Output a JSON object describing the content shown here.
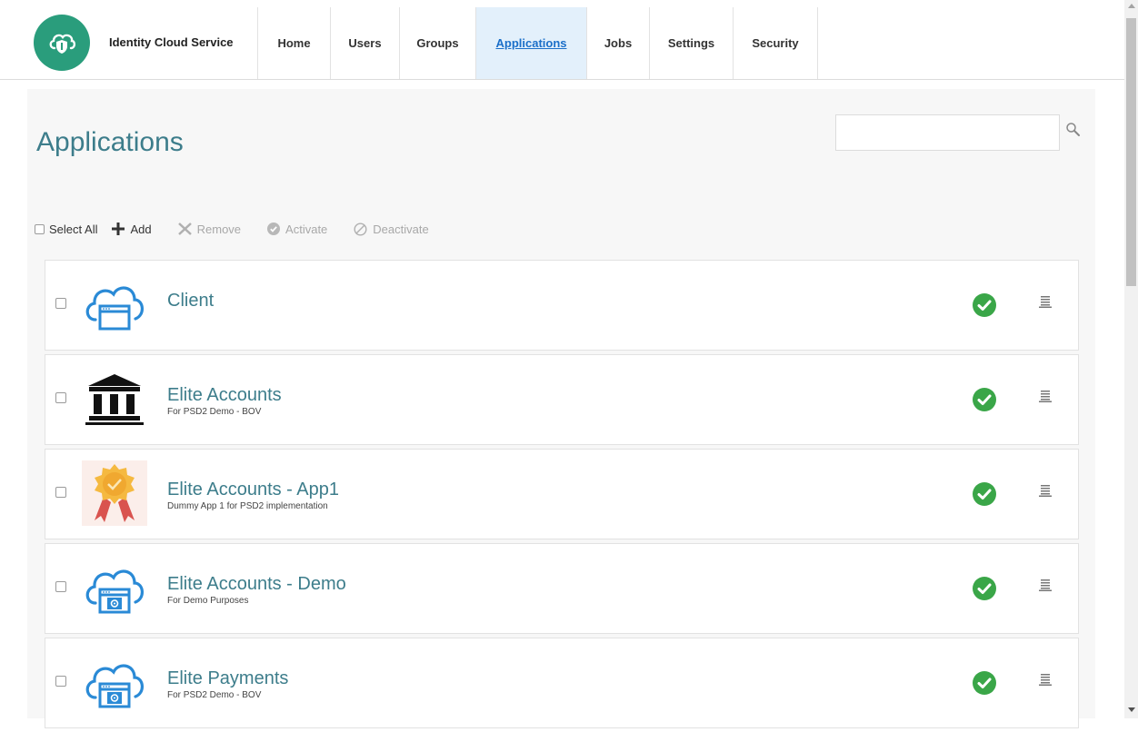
{
  "header": {
    "brand": "Identity Cloud Service",
    "nav": [
      {
        "label": "Home",
        "active": false
      },
      {
        "label": "Users",
        "active": false
      },
      {
        "label": "Groups",
        "active": false
      },
      {
        "label": "Applications",
        "active": true
      },
      {
        "label": "Jobs",
        "active": false
      },
      {
        "label": "Settings",
        "active": false
      },
      {
        "label": "Security",
        "active": false
      }
    ]
  },
  "page": {
    "title": "Applications",
    "search_value": ""
  },
  "toolbar": {
    "select_all": "Select All",
    "add": "Add",
    "remove": "Remove",
    "activate": "Activate",
    "deactivate": "Deactivate"
  },
  "apps": [
    {
      "name": "Client",
      "description": "",
      "icon": "cloud-window-icon",
      "status": "active"
    },
    {
      "name": "Elite Accounts",
      "description": "For PSD2 Demo - BOV",
      "icon": "bank-icon",
      "status": "active"
    },
    {
      "name": "Elite Accounts - App1",
      "description": "Dummy App 1 for PSD2 implementation",
      "icon": "award-badge-icon",
      "status": "active"
    },
    {
      "name": "Elite Accounts - Demo",
      "description": "For Demo Purposes",
      "icon": "cloud-gear-icon",
      "status": "active"
    },
    {
      "name": "Elite Payments",
      "description": "For PSD2 Demo - BOV",
      "icon": "cloud-gear-icon",
      "status": "active"
    }
  ],
  "colors": {
    "brand_green": "#2a9d7c",
    "title_teal": "#3d7d8b",
    "status_green": "#3aa648",
    "active_nav_bg": "#e3f0fb",
    "active_nav_text": "#1b6fc9",
    "cloud_blue": "#2a8ad6"
  }
}
